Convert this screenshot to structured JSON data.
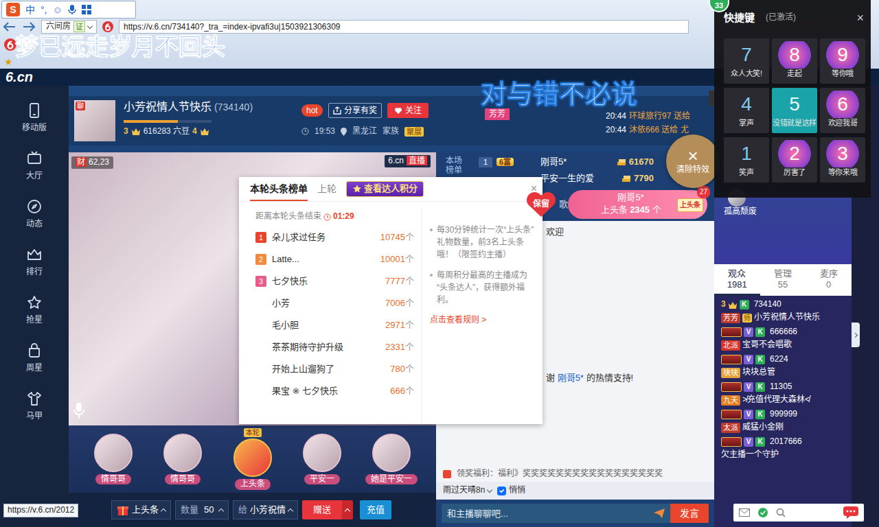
{
  "ime": {
    "logo": "S",
    "items": [
      "中",
      "°,",
      "☺"
    ]
  },
  "browser": {
    "tab_label": "六间房",
    "tab_badge": "证",
    "address": "https://v.6.cn/734140?_tra_=index-ipvafi3u|1503921306309",
    "bookmark": "★",
    "status_url": "https://v.6.cn/2012"
  },
  "lyrics": {
    "top": "梦已远走岁月不回头",
    "main": "对与错不必说",
    "singer": "芳芳"
  },
  "site": {
    "logo": "6.cn"
  },
  "sidebar": {
    "items": [
      {
        "label": "移动版"
      },
      {
        "label": "大厅"
      },
      {
        "label": "动态"
      },
      {
        "label": "排行"
      },
      {
        "label": "抢星"
      },
      {
        "label": "周星"
      },
      {
        "label": "马甲"
      }
    ]
  },
  "room": {
    "avatar_badge": "聊",
    "title": "小芳祝情人节快乐",
    "room_id": "(734140)",
    "level": 0.62,
    "level_from": "3",
    "beans": "616283 六豆",
    "level_to": "4",
    "hot": "hot",
    "share": "分享有奖",
    "follow": "关注",
    "time": "19:53",
    "location": "黑龙江",
    "family_label": "家族",
    "family": "聚展"
  },
  "gift_feed": [
    {
      "time": "20:44",
      "text": "环球旅行97 送给"
    },
    {
      "time": "20:44",
      "text": "沐依666 送给 尤"
    }
  ],
  "video": {
    "badge": "财",
    "viewers": "62,23",
    "brand": "6.cn",
    "live": "直播"
  },
  "headline": {
    "tabs": [
      {
        "label": "本轮头条榜单",
        "selected": true
      },
      {
        "label": "上轮",
        "selected": false
      }
    ],
    "points": "查看达人积分",
    "close": "×",
    "countdown_label": "距离本轮头条结束",
    "countdown": "01:29",
    "rows": [
      {
        "rank": "1",
        "name": "朵儿求过任务",
        "count": "10745",
        "unit": "个"
      },
      {
        "rank": "2",
        "name": "Latte...",
        "count": "10001",
        "unit": "个"
      },
      {
        "rank": "3",
        "name": "七夕快乐",
        "count": "7777",
        "unit": "个"
      },
      {
        "name": "小芳",
        "count": "7006",
        "unit": "个"
      },
      {
        "name": "毛小胆",
        "count": "2971",
        "unit": "个"
      },
      {
        "name": "茶茶期待守护升级",
        "count": "2331",
        "unit": "个"
      },
      {
        "name": "开始上山遛狗了",
        "count": "780",
        "unit": "个"
      },
      {
        "name": "果宝 ※ 七夕快乐",
        "count": "666",
        "unit": "个"
      }
    ],
    "rules": [
      "每30分钟统计一次“上头条”礼物数量，前3名上头条哦！（限签约主播）",
      "每周积分最高的主播成为“头条达人”，获得额外福利。"
    ],
    "rules_link": "点击查看规则 >"
  },
  "rank_board": {
    "title": "本场榜单",
    "rows": [
      {
        "rank": "1",
        "badge": "6富",
        "name": "刚哥5*",
        "score": "61670"
      },
      {
        "name": "平安一生的爱",
        "score": "7790"
      }
    ]
  },
  "keep": "保留",
  "banner": {
    "name": "刚哥5*",
    "action": "上头条",
    "count": "2345",
    "unit": "个",
    "tag": "上头条",
    "num": "27"
  },
  "clear_effects": {
    "icon": "×",
    "label": "清除特效"
  },
  "chat": {
    "tab_fragment": "歌",
    "messages": [
      {
        "prefix": "欢迎"
      },
      {
        "prefix": "谢",
        "name": "刚哥5*",
        "suffix": "的热情支持!"
      }
    ],
    "welfare": "领奖福利：福利》奖奖奖奖奖奖奖奖奖奖奖奖奖奖奖奖奖",
    "target": "雨过天晴8n",
    "whisper": {
      "label": "悄悄",
      "checked": true
    },
    "placeholder": "和主播聊聊吧...",
    "send": "发言"
  },
  "host_mini": {
    "name": "孤高颓废"
  },
  "stage": [
    {
      "name": "情哥哥",
      "kind": "user"
    },
    {
      "name": "情哥哥",
      "kind": "user"
    },
    {
      "name": "上头条",
      "tag": "本轮",
      "kind": "headline"
    },
    {
      "name": "平安一",
      "kind": "user"
    },
    {
      "name": "她是平安一",
      "kind": "user"
    }
  ],
  "gift_bar": {
    "gift": "上头条",
    "qty_label": "数量",
    "qty": "50",
    "to_label": "给",
    "to": "小芳祝情",
    "send": "赠送",
    "recharge": "充值"
  },
  "audience": {
    "tabs": [
      {
        "label": "观众",
        "count": "1981",
        "selected": true
      },
      {
        "label": "管理",
        "count": "55",
        "selected": false
      },
      {
        "label": "麦序",
        "count": "0",
        "selected": false
      }
    ],
    "users": [
      {
        "crown": "3",
        "badges": [
          "K"
        ],
        "id": "734140",
        "tag": "芳芳",
        "color": "#c0392b",
        "role": "师",
        "name": "小芳祝情人节快乐"
      },
      {
        "badges": [
          "V",
          "K"
        ],
        "id": "666666",
        "tag": "北派",
        "color": "#d9342b",
        "name": "宝哥不会唱歌"
      },
      {
        "badges": [
          "V",
          "K"
        ],
        "id": "6224",
        "tag": "块块",
        "color": "#e6a23c",
        "name": "块块总管"
      },
      {
        "badges": [
          "V",
          "K"
        ],
        "id": "11305",
        "tag": "九天",
        "color": "#e67e22",
        "name": "≯充值代理大森林≮"
      },
      {
        "badges": [
          "V",
          "K"
        ],
        "id": "999999",
        "tag": "太派",
        "color": "#c0392b",
        "name": "威猛小金刚"
      },
      {
        "badges": [
          "V",
          "K"
        ],
        "id": "2017666",
        "name": "欠主播一个守护"
      }
    ]
  },
  "shortcuts": {
    "badge": "33",
    "title": "快捷键",
    "status": "(已激活)",
    "close": "×",
    "items": [
      {
        "key": "7",
        "label": "众人大笑!",
        "kind": "number",
        "selected": false
      },
      {
        "key": "8",
        "label": "走起",
        "kind": "sticker",
        "selected": false
      },
      {
        "key": "9",
        "label": "等你哦",
        "kind": "sticker",
        "selected": false
      },
      {
        "key": "4",
        "label": "掌声",
        "kind": "number",
        "selected": false
      },
      {
        "key": "5",
        "label": "没错就是这样",
        "kind": "number",
        "selected": true
      },
      {
        "key": "6",
        "label": "欢迎我哥",
        "kind": "sticker",
        "selected": false
      },
      {
        "key": "1",
        "label": "笑声",
        "kind": "number",
        "selected": false
      },
      {
        "key": "2",
        "label": "厉害了",
        "kind": "sticker",
        "selected": false
      },
      {
        "key": "3",
        "label": "等你来哦",
        "kind": "sticker",
        "selected": false
      }
    ]
  }
}
